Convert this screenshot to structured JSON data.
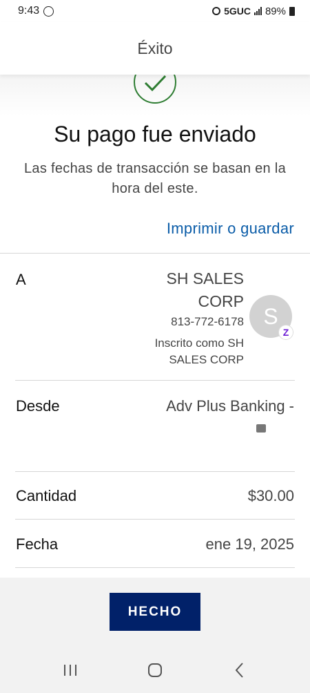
{
  "status_bar": {
    "time": "9:43",
    "network": "5GUC",
    "battery": "89%",
    "icons": [
      "whatsapp-icon",
      "alarm-icon",
      "signal-icon",
      "battery-icon"
    ]
  },
  "header": {
    "title": "Éxito"
  },
  "hero": {
    "title": "Su pago fue enviado",
    "subtitle": "Las fechas de transacción se basan en la hora del este.",
    "print_link": "Imprimir o guardar",
    "check_color": "#2e7d32"
  },
  "details": {
    "to": {
      "label": "A",
      "name": "SH SALES CORP",
      "phone": "813-772-6178",
      "enrolled": "Inscrito como SH SALES CORP",
      "avatar_initial": "S",
      "badge": "Z"
    },
    "from": {
      "label": "Desde",
      "account": "Adv Plus Banking -"
    },
    "amount": {
      "label": "Cantidad",
      "value": "$30.00"
    },
    "date": {
      "label": "Fecha",
      "value": "ene 19, 2025"
    }
  },
  "done_button": {
    "label": "HECHO",
    "color": "#012169"
  },
  "nav": {
    "buttons": [
      "recents-icon",
      "home-icon",
      "back-icon"
    ]
  },
  "colors": {
    "link": "#0a5ca8",
    "zelle": "#6d1ed4"
  }
}
